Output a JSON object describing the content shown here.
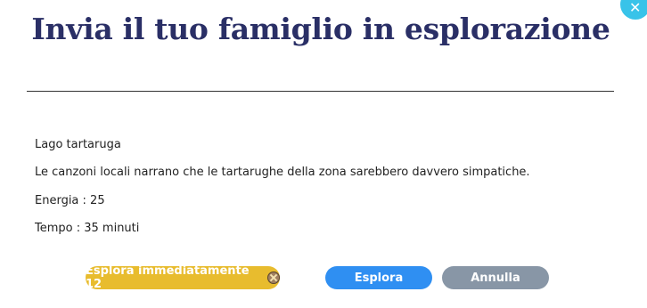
{
  "modal": {
    "title": "Invia il tuo famiglio in esplorazione",
    "location_name": "Lago tartaruga",
    "description": "Le canzoni locali narrano che le tartarughe della zona sarebbero davvero simpatiche.",
    "energy": "Energia : 25",
    "time": "Tempo : 35 minuti"
  },
  "buttons": {
    "immediate_label": "Esplora immediatamente 12",
    "explore_label": "Esplora",
    "cancel_label": "Annulla"
  },
  "icons": {
    "close": "close-icon",
    "coin": "coin-icon"
  },
  "colors": {
    "title": "#2a2f66",
    "immediate_button": "#e8bc2e",
    "explore_button": "#2f8ff2",
    "cancel_button": "#8896a6",
    "close_button": "#38c3e9"
  }
}
